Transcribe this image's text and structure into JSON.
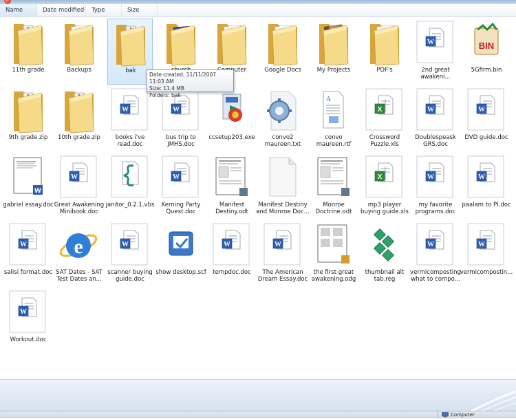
{
  "columns": [
    {
      "label": "Name",
      "sorted": true,
      "width": 54
    },
    {
      "label": "Date modified",
      "sorted": false,
      "width": 71
    },
    {
      "label": "Type",
      "sorted": false,
      "width": 52
    },
    {
      "label": "Size",
      "sorted": false,
      "width": 52
    }
  ],
  "items": [
    {
      "label": "11th grade",
      "kind": "folder-zip",
      "row": 0,
      "col": 0
    },
    {
      "label": "Backups",
      "kind": "folder-docs",
      "row": 0,
      "col": 1
    },
    {
      "label": "bak",
      "kind": "folder-zip",
      "row": 0,
      "col": 2,
      "selected": true
    },
    {
      "label": "church",
      "kind": "folder-blue",
      "row": 0,
      "col": 3
    },
    {
      "label": "Computer",
      "kind": "folder-docs",
      "row": 0,
      "col": 4
    },
    {
      "label": "Google Docs",
      "kind": "folder-docs",
      "row": 0,
      "col": 5
    },
    {
      "label": "My Projects",
      "kind": "folder-photo",
      "row": 0,
      "col": 6
    },
    {
      "label": "PDF's",
      "kind": "folder-docs",
      "row": 0,
      "col": 7
    },
    {
      "label": "2nd great awakeni...",
      "kind": "word",
      "row": 0,
      "col": 8
    },
    {
      "label": "5Gfirm.bin",
      "kind": "bin",
      "row": 0,
      "col": 9
    },
    {
      "label": "9th grade.zip",
      "kind": "zip",
      "row": 1,
      "col": 0
    },
    {
      "label": "10th grade.zip",
      "kind": "zip",
      "row": 1,
      "col": 1
    },
    {
      "label": "books i've read.doc",
      "kind": "word",
      "row": 1,
      "col": 2
    },
    {
      "label": "bus trip to JMHS.doc",
      "kind": "word",
      "row": 1,
      "col": 3
    },
    {
      "label": "ccsetup203.exe",
      "kind": "exe",
      "row": 1,
      "col": 4
    },
    {
      "label": "convo2 maureen.txt",
      "kind": "gear",
      "row": 1,
      "col": 5
    },
    {
      "label": "convo maureen.rtf",
      "kind": "rtf",
      "row": 1,
      "col": 6
    },
    {
      "label": "Crossword Puzzle.xls",
      "kind": "excel",
      "row": 1,
      "col": 7
    },
    {
      "label": "Doublespeask GRS.doc",
      "kind": "word",
      "row": 1,
      "col": 8
    },
    {
      "label": "DVD guide.doc",
      "kind": "word",
      "row": 1,
      "col": 9
    },
    {
      "label": "gabriel essay.doc",
      "kind": "docthumb",
      "row": 2,
      "col": 0
    },
    {
      "label": "Great Awakening Minibook.doc",
      "kind": "word",
      "row": 2,
      "col": 1
    },
    {
      "label": "janitor_0.2.1.vbs",
      "kind": "vbs",
      "row": 2,
      "col": 2
    },
    {
      "label": "Kerning Party Quest.doc",
      "kind": "word",
      "row": 2,
      "col": 3
    },
    {
      "label": "Manifest Destiny.odt",
      "kind": "odt",
      "row": 2,
      "col": 4
    },
    {
      "label": "Manifest Destiny and Monroe Doc...",
      "kind": "blank",
      "row": 2,
      "col": 5
    },
    {
      "label": "Monroe Doctrine.odt",
      "kind": "odt",
      "row": 2,
      "col": 6
    },
    {
      "label": "mp3 player buying guide.xls",
      "kind": "excel",
      "row": 2,
      "col": 7
    },
    {
      "label": "my favorite programs.doc",
      "kind": "word",
      "row": 2,
      "col": 8
    },
    {
      "label": "paalam to PI.doc",
      "kind": "word",
      "row": 2,
      "col": 9
    },
    {
      "label": "salisi format.doc",
      "kind": "word",
      "row": 3,
      "col": 0
    },
    {
      "label": "SAT Dates - SAT Test Dates an...",
      "kind": "ie",
      "row": 3,
      "col": 1
    },
    {
      "label": "scanner buying guide.doc",
      "kind": "word",
      "row": 3,
      "col": 2
    },
    {
      "label": "show desktop.scf",
      "kind": "scf",
      "row": 3,
      "col": 3
    },
    {
      "label": "tempdoc.doc",
      "kind": "word",
      "row": 3,
      "col": 4
    },
    {
      "label": "The American Dream Essay.doc",
      "kind": "word",
      "row": 3,
      "col": 5
    },
    {
      "label": "the first great awakening.odg",
      "kind": "odg",
      "row": 3,
      "col": 6
    },
    {
      "label": "thumbnail alt tab.reg",
      "kind": "reg",
      "row": 3,
      "col": 7
    },
    {
      "label": "vermicomposting what to compo...",
      "kind": "word",
      "row": 3,
      "col": 8
    },
    {
      "label": "vermicompostin...",
      "kind": "word",
      "row": 3,
      "col": 9
    },
    {
      "label": "Workout.doc",
      "kind": "word",
      "row": 4,
      "col": 0
    }
  ],
  "tooltip": {
    "line1": "Date created: 11/11/2007 11:03 AM",
    "line2": "Size: 11.4 MB",
    "line3": "Folders: bak"
  },
  "status": {
    "location": "Computer"
  },
  "colors": {
    "folder": "#f3d27a",
    "word_blue": "#2d5fb4",
    "excel_green": "#2f8a3a",
    "selection": "#d6e9fa"
  }
}
